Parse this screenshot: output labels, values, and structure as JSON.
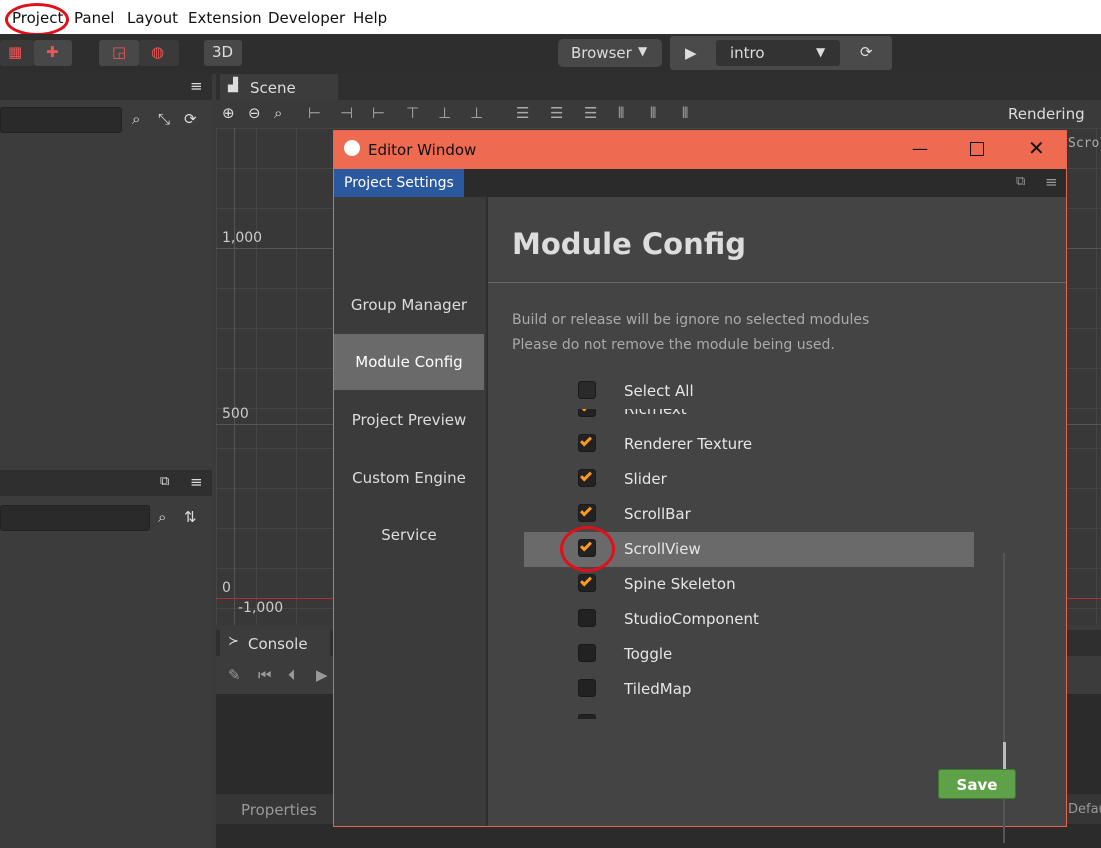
{
  "menu": [
    "Project",
    "Panel",
    "Layout",
    "Extension",
    "Developer",
    "Help"
  ],
  "toolbar": {
    "mode_3d": "3D",
    "platform": "Browser",
    "scene_select": "intro"
  },
  "scene_panel": {
    "tab": "Scene",
    "rendering": "Rendering",
    "ruler": [
      "1,000",
      "500",
      "0",
      "-1,000"
    ],
    "corner_text": "Scrol"
  },
  "console_panel": {
    "tab": "Console"
  },
  "properties_panel": {
    "tab": "Properties",
    "corner_text": "Defau"
  },
  "editor_window": {
    "title": "Editor Window",
    "tab": "Project Settings",
    "sidebar": [
      "Group Manager",
      "Module Config",
      "Project Preview",
      "Custom Engine",
      "Service"
    ],
    "active_index": 1,
    "heading": "Module Config",
    "desc1": "Build or release will be ignore no selected modules",
    "desc2": "Please do not remove the module being used.",
    "select_all": "Select All",
    "modules": [
      {
        "label": "RichText",
        "checked": true
      },
      {
        "label": "Renderer Texture",
        "checked": true
      },
      {
        "label": "Slider",
        "checked": true
      },
      {
        "label": "ScrollBar",
        "checked": true
      },
      {
        "label": "ScrollView",
        "checked": true,
        "selected": true
      },
      {
        "label": "Spine Skeleton",
        "checked": true
      },
      {
        "label": "StudioComponent",
        "checked": false
      },
      {
        "label": "Toggle",
        "checked": false
      },
      {
        "label": "TiledMap",
        "checked": false
      }
    ],
    "save": "Save"
  }
}
